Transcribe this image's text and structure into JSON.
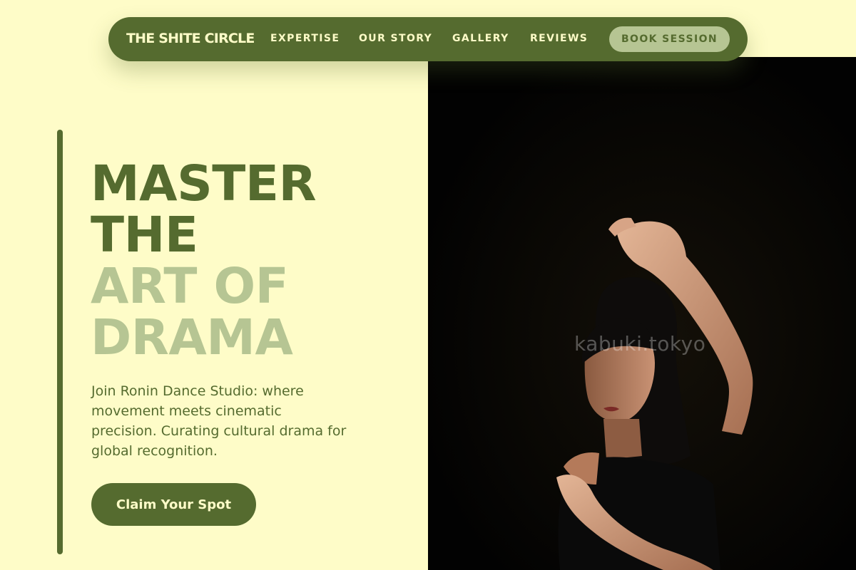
{
  "nav": {
    "brand": "THE SHITE CIRCLE",
    "links": [
      "EXPERTISE",
      "OUR STORY",
      "GALLERY",
      "REVIEWS"
    ],
    "cta": "BOOK SESSION"
  },
  "hero": {
    "headline": {
      "line1": "MASTER",
      "line2": "THE",
      "line3": "ART OF",
      "line4": "DRAMA"
    },
    "subtext": "Join Ronin Dance Studio: where movement meets cinematic precision. Curating cultural drama for global recognition.",
    "cta": "Claim Your Spot",
    "image": {
      "subject": "dancer-photo",
      "watermark": "kabuki.tokyo"
    }
  },
  "colors": {
    "background": "#fefcc8",
    "primary": "#556b2f",
    "accent_light": "#b6c593",
    "image_bg": "#020202"
  }
}
